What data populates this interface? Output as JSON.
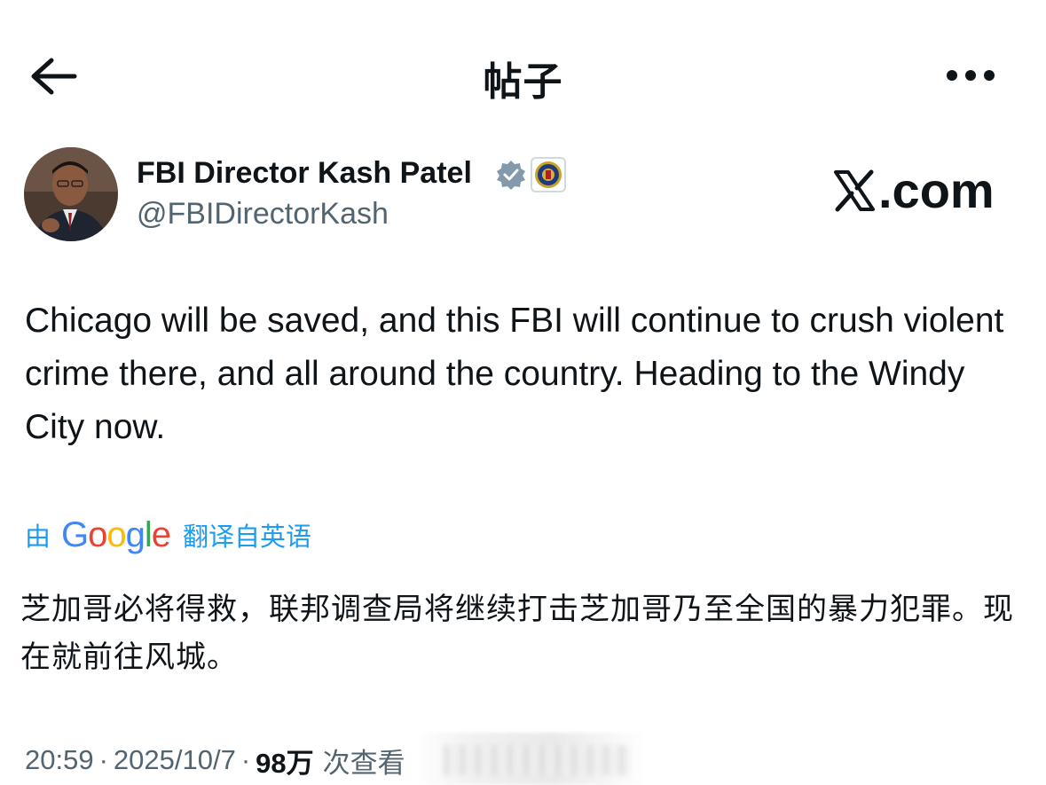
{
  "header": {
    "title": "帖子",
    "back_icon": "arrow-left-icon",
    "more_icon": "more-horizontal-icon"
  },
  "author": {
    "name": "FBI Director Kash Patel",
    "handle": "@FBIDirectorKash",
    "verified_icon": "verified-badge-icon",
    "affiliate_icon": "fbi-seal-icon"
  },
  "watermark": {
    "text": ".com",
    "logo": "x-logo-icon"
  },
  "post": {
    "text": "Chicago will be saved, and this FBI will continue to crush violent crime there, and all around the country.  Heading to the Windy City now."
  },
  "translation": {
    "by_label": "由",
    "google_logo": "Google",
    "translated_from": "翻译自英语",
    "translated_text": "芝加哥必将得救，联邦调查局将继续打击芝加哥乃至全国的暴力犯罪。现在就前往风城。"
  },
  "meta": {
    "time": "20:59",
    "separator": "·",
    "date": "2025/10/7",
    "views_count": "98万",
    "views_label": "次查看"
  },
  "colors": {
    "link_blue": "#1d9bf0",
    "secondary_text": "#536471",
    "primary_text": "#0f1419",
    "verified_gray": "#829aab"
  }
}
